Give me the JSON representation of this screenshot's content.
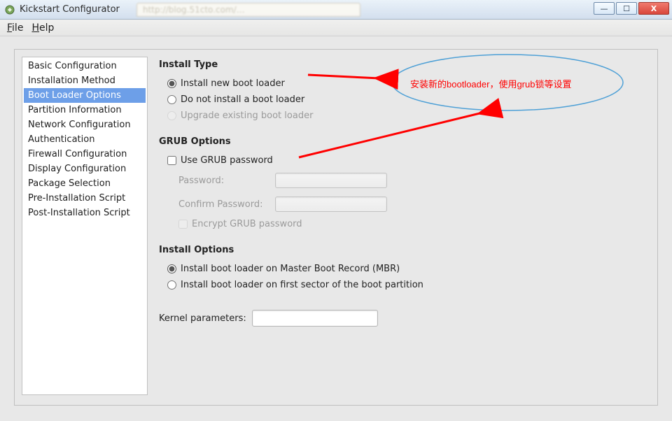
{
  "window": {
    "title": "Kickstart Configurator",
    "behind_tab_blur": "http://blog.51cto.com/…"
  },
  "win_buttons": {
    "min": "—",
    "max": "☐",
    "close": "X"
  },
  "menubar": {
    "file": {
      "label": "File",
      "hotkey": "F"
    },
    "help": {
      "label": "Help",
      "hotkey": "H"
    }
  },
  "sidebar": {
    "items": [
      "Basic Configuration",
      "Installation Method",
      "Boot Loader Options",
      "Partition Information",
      "Network Configuration",
      "Authentication",
      "Firewall Configuration",
      "Display Configuration",
      "Package Selection",
      "Pre-Installation Script",
      "Post-Installation Script"
    ],
    "selected_index": 2
  },
  "sections": {
    "install_type": {
      "title": "Install Type",
      "opt_new": {
        "label": "Install new boot loader",
        "checked": true
      },
      "opt_none": {
        "label": "Do not install a boot loader",
        "checked": false
      },
      "opt_upgrade": {
        "label": "Upgrade existing boot loader",
        "checked": false,
        "disabled": true
      }
    },
    "grub": {
      "title": "GRUB Options",
      "use_password": {
        "label": "Use GRUB password",
        "checked": false
      },
      "password_label": "Password:",
      "confirm_label": "Confirm Password:",
      "encrypt": {
        "label": "Encrypt GRUB password",
        "checked": false,
        "disabled": true
      }
    },
    "install_options": {
      "title": "Install Options",
      "opt_mbr": {
        "label": "Install boot loader on Master Boot Record (MBR)",
        "checked": true
      },
      "opt_first": {
        "label": "Install boot loader on first sector of the boot partition",
        "checked": false
      }
    },
    "kernel": {
      "label": "Kernel parameters:",
      "value": ""
    }
  },
  "annotation": {
    "text": "安装新的bootloader，使用grub锁等设置"
  }
}
